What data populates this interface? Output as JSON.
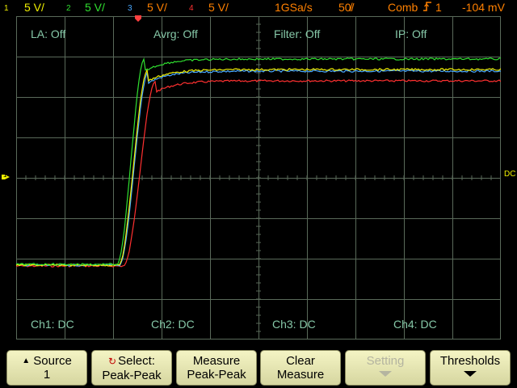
{
  "status_bar": {
    "ch1": {
      "num": "1",
      "scale": "5 V/",
      "color": "#f0f000"
    },
    "ch2": {
      "num": "2",
      "scale": "5 V/",
      "color": "#30e030"
    },
    "ch3": {
      "num": "3",
      "scale": "5 V/",
      "color": "#4aa8ff"
    },
    "ch4": {
      "num": "4",
      "scale": "5 V/",
      "color": "#ff3030"
    },
    "sample_rate": "1GSa/s",
    "timebase": "50̸/",
    "trigger_mode": "Comb",
    "trigger_icon": "rising-edge-icon",
    "trigger_source": "1",
    "trigger_level": "-104 mV",
    "text_color": "#ff8000"
  },
  "screen_info": {
    "la": "LA: Off",
    "avrg": "Avrg: Off",
    "filter": "Filter: Off",
    "ip": "IP: Off",
    "ch1_coupling": "Ch1: DC",
    "ch2_coupling": "Ch2: DC",
    "ch3_coupling": "Ch3: DC",
    "ch4_coupling": "Ch4: DC"
  },
  "markers": {
    "trigger_position_icon": "trigger-position-icon",
    "ground_marker_label": "1",
    "right_marker_label": "DC"
  },
  "colors": {
    "grid": "#5a6a5a",
    "trace_ch1": "#f0f000",
    "trace_ch2": "#30e030",
    "trace_ch3": "#4aa8ff",
    "trace_ch4": "#ff3030",
    "softkey_bg": "#e8e8b4"
  },
  "softkeys": [
    {
      "line1": "Source",
      "line2": "1",
      "icon": "up-triangle-icon",
      "enabled": true
    },
    {
      "line1": "Select:",
      "line2": "Peak-Peak",
      "icon": "select-knob-icon",
      "enabled": true
    },
    {
      "line1": "Measure",
      "line2": "Peak-Peak",
      "icon": "",
      "enabled": true
    },
    {
      "line1": "Clear",
      "line2": "Measure",
      "icon": "",
      "enabled": true
    },
    {
      "line1": "Setting",
      "line2": "",
      "icon": "down-arrow-icon",
      "enabled": false
    },
    {
      "line1": "Thresholds",
      "line2": "",
      "icon": "down-arrow-icon",
      "enabled": true
    }
  ]
}
